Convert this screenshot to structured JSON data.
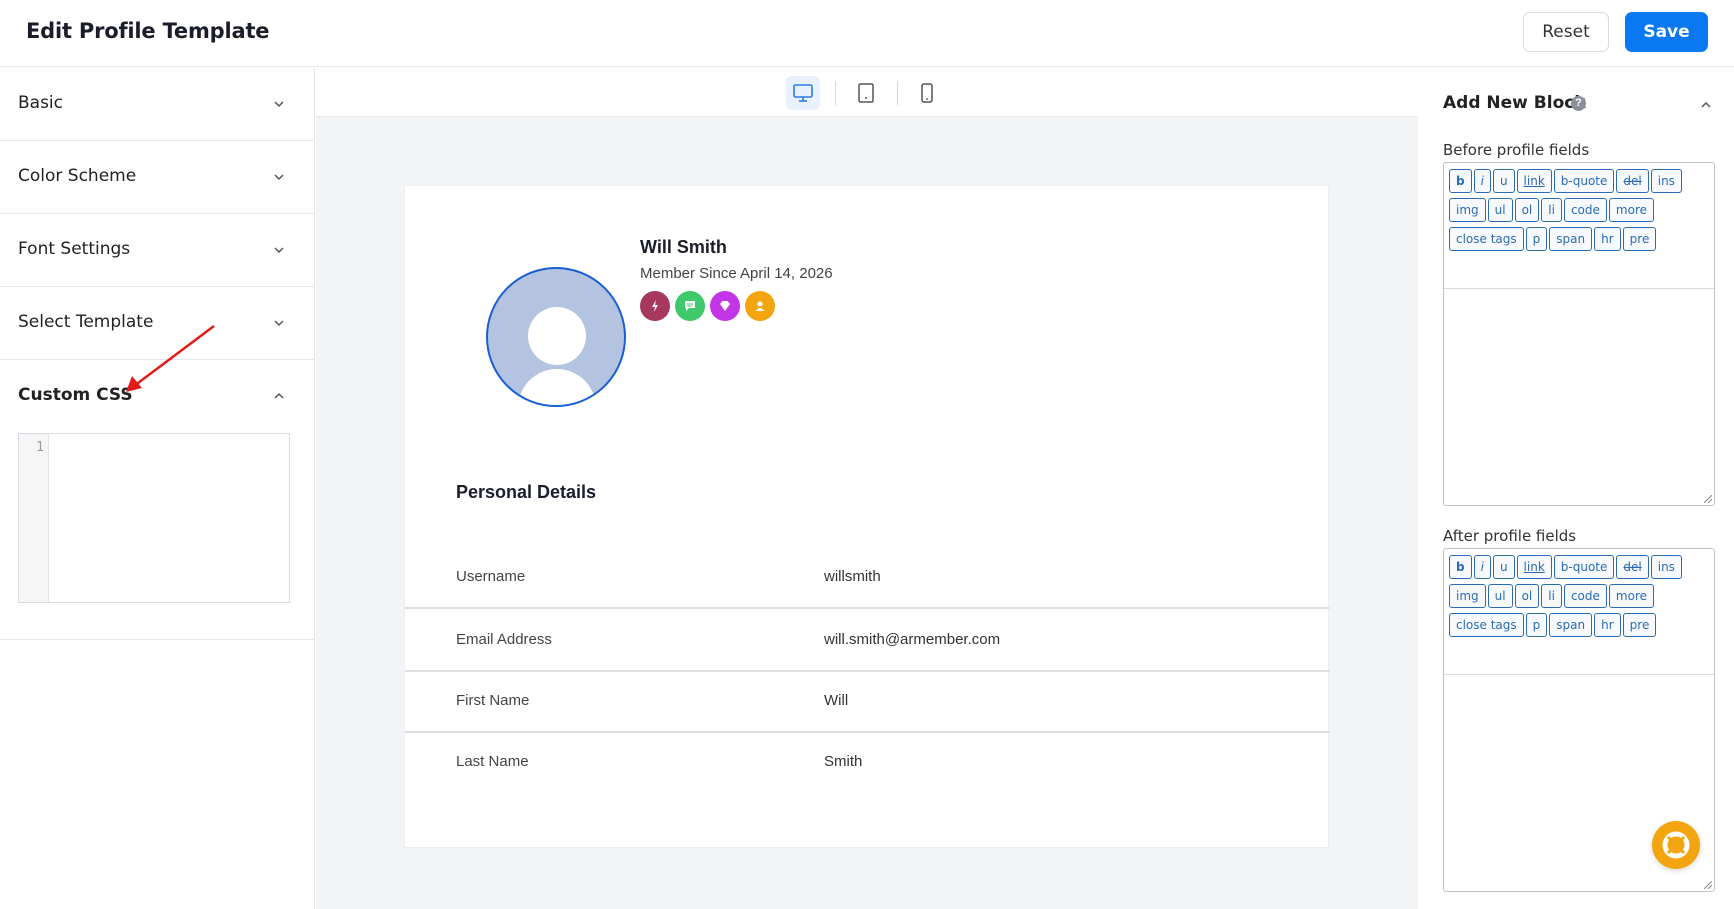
{
  "header": {
    "title": "Edit Profile Template",
    "reset_label": "Reset",
    "save_label": "Save"
  },
  "left_panel": {
    "sections": [
      {
        "label": "Basic",
        "state": "collapsed"
      },
      {
        "label": "Color Scheme",
        "state": "collapsed"
      },
      {
        "label": "Font Settings",
        "state": "collapsed"
      },
      {
        "label": "Select Template",
        "state": "collapsed"
      },
      {
        "label": "Custom CSS",
        "state": "expanded"
      }
    ],
    "css_editor": {
      "line_number": "1",
      "value": ""
    }
  },
  "device_bar": {
    "options": [
      "desktop-icon",
      "tablet-icon",
      "mobile-icon"
    ],
    "active": "desktop-icon"
  },
  "profile": {
    "name": "Will Smith",
    "member_since": "Member Since April 14, 2026",
    "badges": [
      {
        "icon": "bolt-icon",
        "color": "#a6385f"
      },
      {
        "icon": "chat-icon",
        "color": "#3ec96a"
      },
      {
        "icon": "diamond-icon",
        "color": "#c236e8"
      },
      {
        "icon": "user-icon",
        "color": "#f3a510"
      }
    ],
    "section_title": "Personal Details",
    "fields": [
      {
        "label": "Username",
        "value": "willsmith"
      },
      {
        "label": "Email Address",
        "value": "will.smith@armember.com"
      },
      {
        "label": "First Name",
        "value": "Will"
      },
      {
        "label": "Last Name",
        "value": "Smith"
      }
    ]
  },
  "right_panel": {
    "title": "Add New Block",
    "help": "?",
    "before_label": "Before profile fields",
    "after_label": "After profile fields",
    "toolbar_buttons": [
      "b",
      "i",
      "u",
      "link",
      "b-quote",
      "del",
      "ins",
      "img",
      "ul",
      "ol",
      "li",
      "code",
      "more",
      "close tags",
      "p",
      "span",
      "hr",
      "pre"
    ]
  },
  "colors": {
    "accent": "#0a78f0",
    "avatar_border": "#1a5fd3",
    "support": "#f3a510"
  }
}
